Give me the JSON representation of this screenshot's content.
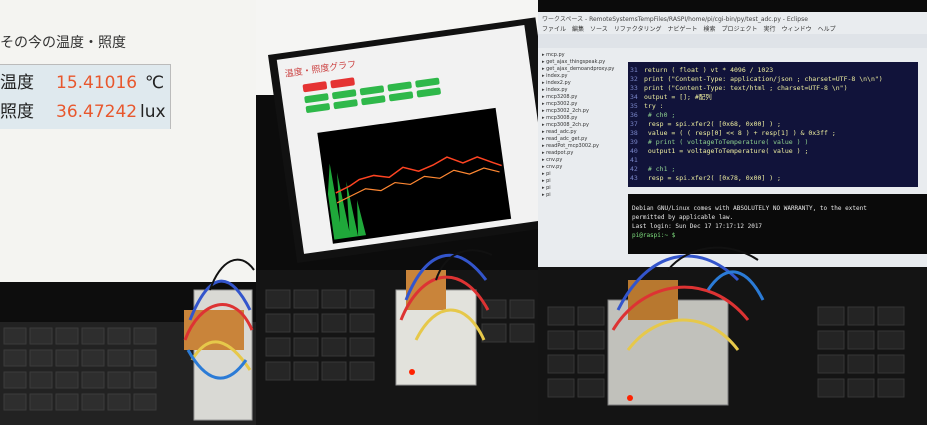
{
  "panel1": {
    "title": "その今の温度・照度",
    "temperature": {
      "label": "温度",
      "value": "15.41016",
      "unit": "℃"
    },
    "illuminance": {
      "label": "照度",
      "value": "36.47242",
      "unit": "lux"
    },
    "value_color": "#e8572d"
  },
  "panel2": {
    "page_header": "温度・照度グラフ",
    "buttons_row1": [
      "",
      ""
    ],
    "buttons_row2": [
      "",
      "",
      "",
      "",
      ""
    ],
    "buttons_row3": [
      "",
      "",
      "",
      "",
      ""
    ],
    "graph_series": [
      {
        "color": "#ff4422"
      },
      {
        "color": "#ff8833"
      },
      {
        "color": "#22bb22"
      }
    ]
  },
  "panel3": {
    "title_bar": "ワークスペース - RemoteSystemsTempFiles/RASPI/home/pi/cgi-bin/py/test_adc.py - Eclipse",
    "menu": [
      "ファイル",
      "編集",
      "ソース",
      "リファクタリング",
      "ナビゲート",
      "検索",
      "プロジェクト",
      "実行",
      "ウィンドウ",
      "ヘルプ"
    ],
    "files": [
      "mcp.py",
      "get_ajax_thingspeak.py",
      "get_ajax_demoandproxy.py",
      "index.py",
      "index2.py",
      "index.py",
      "mcp3208.py",
      "mcp3002.py",
      "mcp3002_2ch.py",
      "mcp3008.py",
      "mcp3008_2ch.py",
      "read_adc.py",
      "read_adc_get.py",
      "readPot_mcp3002.py",
      "readpot.py",
      "cnv.py",
      "cnv.py",
      "pi",
      "pi",
      "pi",
      "pi"
    ],
    "code_lines": [
      {
        "no": "31",
        "text": "return ( float ) vt * 4096 / 1023"
      },
      {
        "no": "32",
        "text": "print (\"Content-Type: application/json ; charset=UTF-8 \\n\\n\")"
      },
      {
        "no": "33",
        "text": "print (\"Content-Type: text/html ; charset=UTF-8 \\n\")"
      },
      {
        "no": "34",
        "text": "output = [];  #配列"
      },
      {
        "no": "35",
        "text": "try :"
      },
      {
        "no": "36",
        "text": "    # ch0 ;"
      },
      {
        "no": "37",
        "text": "    resp = spi.xfer2( [0x68, 0x00] ) ;"
      },
      {
        "no": "38",
        "text": "    value = ( ( resp[0] << 8 ) + resp[1] ) & 0x3ff ;"
      },
      {
        "no": "39",
        "text": "    # print ( voltageToTemperature( value ) )"
      },
      {
        "no": "40",
        "text": "    output1 = voltageToTemperature( value ) ;"
      },
      {
        "no": "41",
        "text": ""
      },
      {
        "no": "42",
        "text": "    # ch1 ;"
      },
      {
        "no": "43",
        "text": "    resp = spi.xfer2( [0x78, 0x00] ) ;"
      }
    ],
    "terminal_lines": [
      "Debian GNU/Linux comes with ABSOLUTELY NO WARRANTY, to the extent",
      "permitted by applicable law.",
      "Last login: Sun Dec 17 17:17:12 2017",
      "pi@raspi:~ $"
    ]
  }
}
